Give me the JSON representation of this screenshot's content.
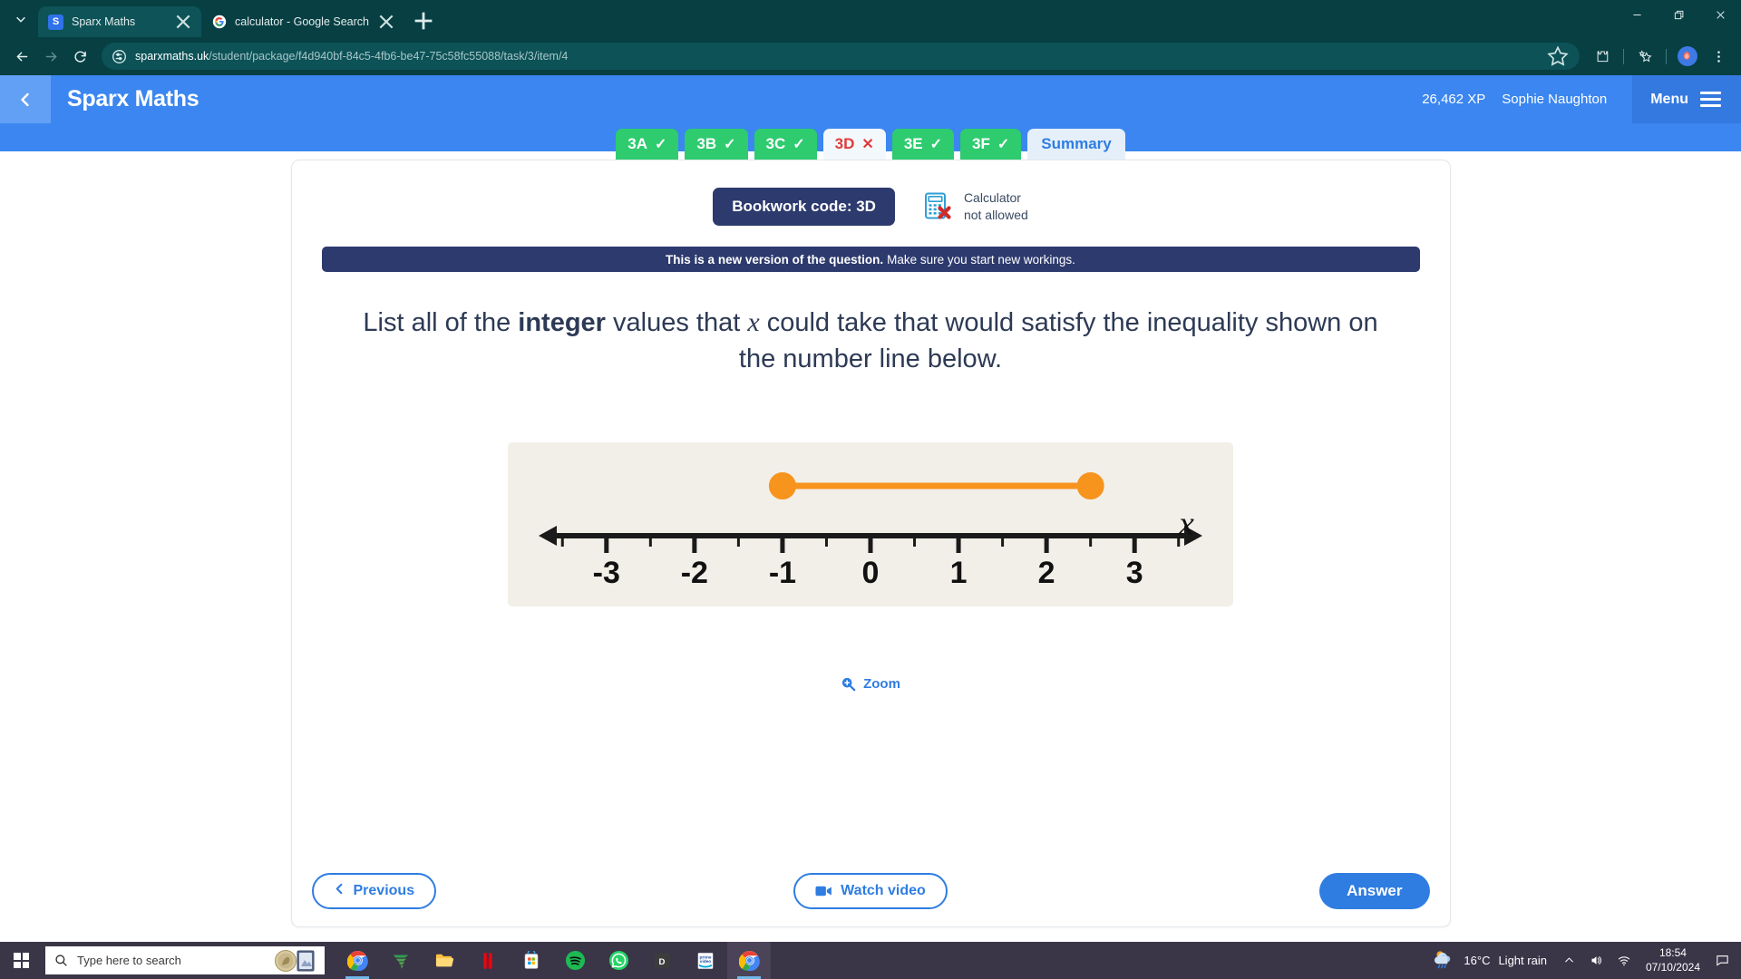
{
  "browser": {
    "tabs": [
      {
        "title": "Sparx Maths",
        "favicon": "sparx-s-icon",
        "active": true
      },
      {
        "title": "calculator - Google Search",
        "favicon": "google-g-icon",
        "active": false
      }
    ],
    "new_tab_label": "+",
    "nav": {
      "back_icon": "back-arrow-icon",
      "forward_icon": "forward-arrow-icon",
      "reload_icon": "reload-icon"
    },
    "omnibox": {
      "site_settings_icon": "tune-icon",
      "url_host": "sparxmaths.uk",
      "url_path": "/student/package/f4d940bf-84c5-4fb6-be47-75c58fc55088/task/3/item/4",
      "bookmark_icon": "star-outline-icon"
    },
    "toolbar_icons": [
      "extensions-puzzle-icon",
      "sparkle-star-icon",
      "profile-avatar",
      "three-dot-menu-icon"
    ],
    "window_controls": [
      "minimize-icon",
      "restore-icon",
      "close-icon"
    ],
    "chrome_bg": "#073f43"
  },
  "sparx": {
    "back_icon": "chevron-left-icon",
    "logo": "Sparx Maths",
    "xp": "26,462 XP",
    "user": "Sophie Naughton",
    "menu_label": "Menu",
    "menu_icon": "hamburger-icon",
    "header_color": "#3b86f0",
    "tabs": [
      {
        "label": "3A",
        "mark": "✓",
        "state": "done"
      },
      {
        "label": "3B",
        "mark": "✓",
        "state": "done"
      },
      {
        "label": "3C",
        "mark": "✓",
        "state": "done"
      },
      {
        "label": "3D",
        "mark": "✕",
        "state": "current"
      },
      {
        "label": "3E",
        "mark": "✓",
        "state": "done"
      },
      {
        "label": "3F",
        "mark": "✓",
        "state": "done"
      },
      {
        "label": "Summary",
        "mark": "",
        "state": "summary"
      }
    ]
  },
  "question_card": {
    "bookwork_code": "Bookwork code: 3D",
    "calculator": {
      "icon": "calculator-not-allowed-icon",
      "line1": "Calculator",
      "line2": "not allowed"
    },
    "banner": {
      "bold": "This is a new version of the question.",
      "rest": "Make sure you start new workings."
    },
    "prompt": {
      "part1": "List all of the ",
      "bold": "integer",
      "part2": " values that ",
      "variable": "x",
      "part3": " could take that would satisfy the inequality shown on the number line below."
    },
    "zoom_link": {
      "label": "Zoom",
      "icon": "zoom-in-magnifier-icon"
    },
    "footer": {
      "previous": {
        "label": "Previous",
        "icon": "chevron-left-icon"
      },
      "watch_video": {
        "label": "Watch video",
        "icon": "video-camera-icon"
      },
      "answer": {
        "label": "Answer"
      }
    }
  },
  "chart_data": {
    "type": "number-line",
    "title": "",
    "xlabel": "x",
    "xlim": [
      -3.75,
      3.75
    ],
    "tick_labels": [
      "-3",
      "-2",
      "-1",
      "0",
      "1",
      "2",
      "3"
    ],
    "major_ticks": [
      -3,
      -2,
      -1,
      0,
      1,
      2,
      3
    ],
    "minor_ticks": [
      -3.5,
      -2.5,
      -1.5,
      -0.5,
      0.5,
      1.5,
      2.5,
      3.5
    ],
    "segments": [
      {
        "start": -1,
        "end": 2.5,
        "start_closed": true,
        "end_closed": true,
        "color": "#f7941e"
      }
    ],
    "line_color": "#1a1a1a",
    "background": "#f2efe8",
    "arrows": [
      "left",
      "right"
    ],
    "grid": false
  },
  "taskbar": {
    "start_icon": "windows-logo-icon",
    "search_placeholder": "Type here to search",
    "search_icon": "magnifier-icon",
    "apps": [
      {
        "name": "chrome-icon"
      },
      {
        "name": "weather-tornado-icon"
      },
      {
        "name": "file-explorer-icon"
      },
      {
        "name": "netflix-icon"
      },
      {
        "name": "microsoft-store-icon"
      },
      {
        "name": "spotify-icon"
      },
      {
        "name": "whatsapp-icon"
      },
      {
        "name": "discord-d-icon"
      },
      {
        "name": "prime-video-icon"
      },
      {
        "name": "chrome-active-icon"
      }
    ],
    "weather_temp": "16°C",
    "weather_desc": "Light rain",
    "tray_icons": [
      "chevron-up-icon",
      "volume-icon",
      "wifi-icon"
    ],
    "time": "18:54",
    "date": "07/10/2024",
    "notification_icon": "notification-icon"
  }
}
